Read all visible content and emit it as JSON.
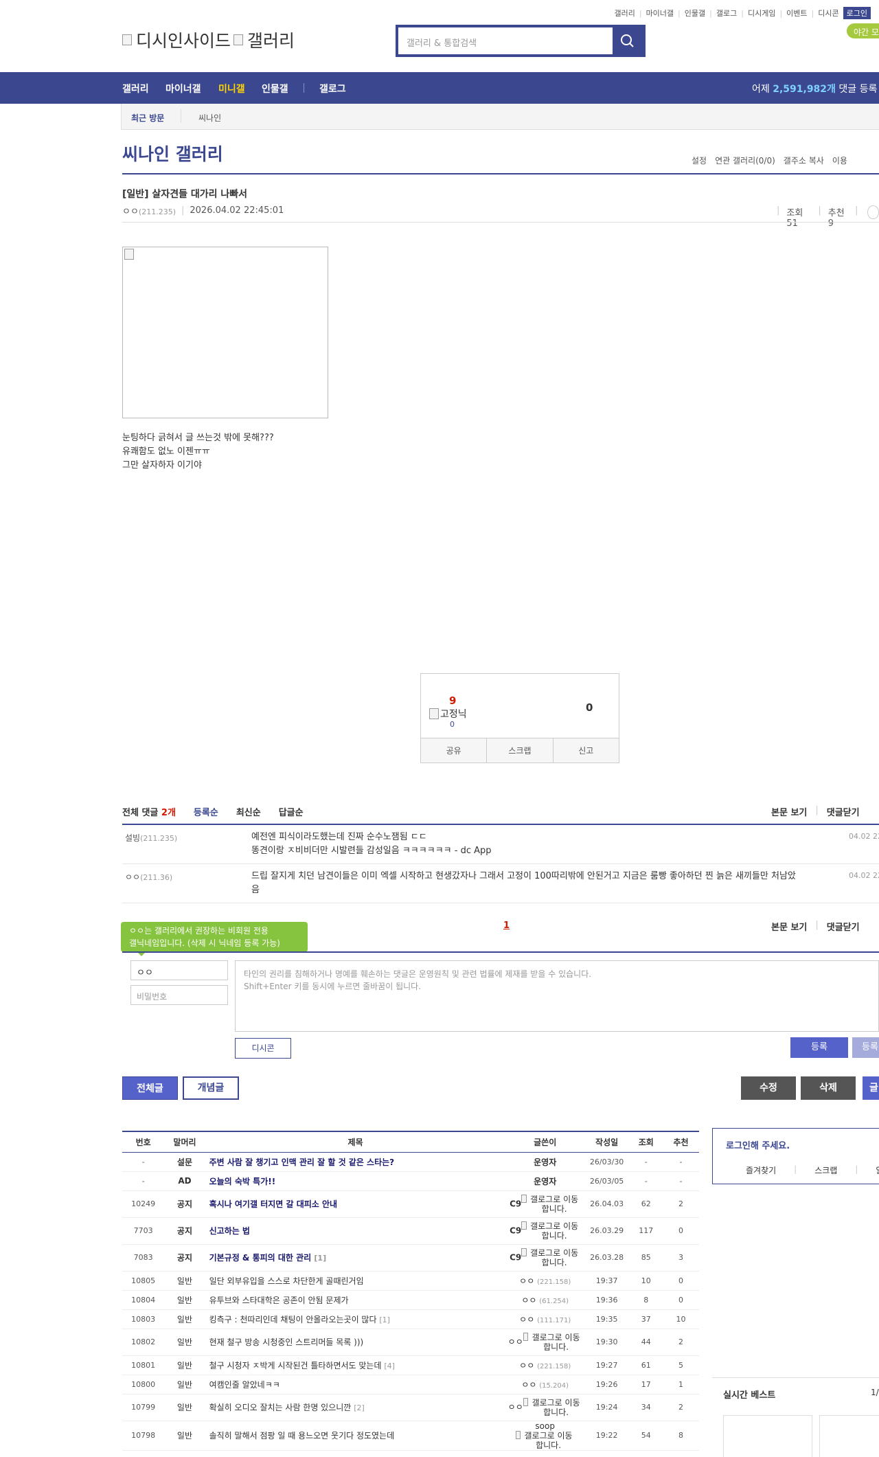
{
  "header": {
    "top_links": [
      "갤러리",
      "마이너갤",
      "인물갤",
      "갤로그",
      "디시게임",
      "이벤트",
      "디시콘"
    ],
    "login": "로그인",
    "logo_left": "디시인사이드",
    "logo_right": "갤러리",
    "search_placeholder": "갤러리 & 통합검색",
    "night_mode": "야간 모드"
  },
  "nav": {
    "items": [
      "갤러리",
      "마이너갤",
      "미니갤",
      "인물갤",
      "갤로그"
    ],
    "active": "미니갤",
    "stat_prefix": "어제",
    "stat_count": "2,591,982개",
    "stat_suffix": "댓글 등록"
  },
  "recent": {
    "label": "최근 방문",
    "item": "씨나인"
  },
  "gallery": {
    "title": "씨나인 갤러리",
    "tools": [
      "설정",
      "연관 갤러리(0/0)",
      "갤주소 복사",
      "이용"
    ]
  },
  "post": {
    "title": "[일반] 살자견들 대가리 나빠서",
    "author": "ㅇㅇ",
    "author_ip": "(211.235)",
    "datetime": "2026.04.02 22:45:01",
    "views": "조회 51",
    "recommend": "추천 9",
    "body_lines": [
      "눈팅하다 긁혀서 글 쓰는것 밖에 못해???",
      "유쾌함도 없노 이젠ㅠㅠ",
      "그만 살자하자 이기야"
    ]
  },
  "vote": {
    "up": "9",
    "fixed_nick": "고정닉",
    "fixed_count": "0",
    "down": "0",
    "buttons": [
      "공유",
      "스크랩",
      "신고"
    ]
  },
  "comments": {
    "total_label": "전체 댓글",
    "total_count": "2개",
    "sorts": [
      "등록순",
      "최신순",
      "답글순"
    ],
    "right_links": [
      "본문 보기",
      "댓글닫기"
    ],
    "list": [
      {
        "author": "설빙",
        "ip": "(211.235)",
        "text": "예전엔 피식이라도했는데 진짜 순수노잼됨 ㄷㄷ\n똥견이랑 ㅈ비비더만 시발련들 감성일음 ㅋㅋㅋㅋㅋㅋ - dc App",
        "date": "04.02 22"
      },
      {
        "author": "ㅇㅇ",
        "ip": "(211.36)",
        "text": "드립 잘지게 치던 남견이들은 이미 엑셀 시작하고 현생갔자나 그래서 고정이 100따리밖에 안된거고 지금은 룸빵 좋아하던 찐 늙은 새끼들만 처남았음",
        "date": "04.02 22"
      }
    ],
    "page": "1"
  },
  "comment_form": {
    "tooltip": "ㅇㅇ는 갤러리에서 권장하는 비회원 전용\n갤닉네임입니다. (삭제 시 닉네임 등록 가능)",
    "nick": "ㅇㅇ",
    "password_placeholder": "비밀번호",
    "textarea_placeholder": "타인의 권리를 침해하거나 명예를 훼손하는 댓글은 운영원칙 및 관련 법률에 제재를 받을 수 있습니다.\nShift+Enter 키를 동시에 누르면 줄바꿈이 됩니다.",
    "dccon": "디시콘",
    "submit": "등록",
    "submit2": "등록"
  },
  "buttons": {
    "all": "전체글",
    "concept": "개념글",
    "edit": "수정",
    "delete": "삭제",
    "write": "글"
  },
  "list": {
    "headers": [
      "번호",
      "말머리",
      "제목",
      "글쓴이",
      "작성일",
      "조회",
      "추천"
    ],
    "rows": [
      {
        "num": "-",
        "head": "설문",
        "title": "주변 사람 잘 챙기고 인맥 관리 잘 할 것 같은 스타는?",
        "reply": "",
        "writer": "운영자",
        "wip": "",
        "gallog": false,
        "date": "26/03/30",
        "views": "-",
        "rec": "-",
        "bold": true
      },
      {
        "num": "-",
        "head": "AD",
        "title": "오늘의 숙박 특가!!",
        "reply": "",
        "writer": "운영자",
        "wip": "",
        "gallog": false,
        "date": "26/03/05",
        "views": "-",
        "rec": "-",
        "bold": true
      },
      {
        "num": "10249",
        "head": "공지",
        "title": "혹시나 여기갤 터지면 갈 대피소 안내",
        "reply": "",
        "writer": "C9",
        "wip": "",
        "gallog": true,
        "date": "26.04.03",
        "views": "62",
        "rec": "2",
        "bold": true
      },
      {
        "num": "7703",
        "head": "공지",
        "title": "신고하는 법",
        "reply": "",
        "writer": "C9",
        "wip": "",
        "gallog": true,
        "date": "26.03.29",
        "views": "117",
        "rec": "0",
        "bold": true
      },
      {
        "num": "7083",
        "head": "공지",
        "title": "기본규정 & 통피의 대한 관리",
        "reply": "[1]",
        "writer": "C9",
        "wip": "",
        "gallog": true,
        "date": "26.03.28",
        "views": "85",
        "rec": "3",
        "bold": true
      },
      {
        "num": "10805",
        "head": "일반",
        "title": "일단 외부유입을 스스로 차단한게 골때린거임",
        "reply": "",
        "writer": "ㅇㅇ",
        "wip": "(221.158)",
        "gallog": false,
        "date": "19:37",
        "views": "10",
        "rec": "0",
        "bold": false
      },
      {
        "num": "10804",
        "head": "일반",
        "title": "유투브와 스타대학은 공존이 안됨 문제가",
        "reply": "",
        "writer": "ㅇㅇ",
        "wip": "(61.254)",
        "gallog": false,
        "date": "19:36",
        "views": "8",
        "rec": "0",
        "bold": false
      },
      {
        "num": "10803",
        "head": "일반",
        "title": "킹측구 : 천따리인데 채팅이 안올라오는곳이 많다",
        "reply": "[1]",
        "writer": "ㅇㅇ",
        "wip": "(111.171)",
        "gallog": false,
        "date": "19:35",
        "views": "37",
        "rec": "10",
        "bold": false
      },
      {
        "num": "10802",
        "head": "일반",
        "title": "현재 철구 방송 시청중인 스트리머들 목록 )))",
        "reply": "",
        "writer": "ㅇㅇ",
        "wip": "",
        "gallog": true,
        "date": "19:30",
        "views": "44",
        "rec": "2",
        "bold": false
      },
      {
        "num": "10801",
        "head": "일반",
        "title": "철구 시청자 ㅈ박게 시작된건 틀타하면서도 맞는데",
        "reply": "[4]",
        "writer": "ㅇㅇ",
        "wip": "(221.158)",
        "gallog": false,
        "date": "19:27",
        "views": "61",
        "rec": "5",
        "bold": false
      },
      {
        "num": "10800",
        "head": "일반",
        "title": "여캠인줄 알았네ㅋㅋ",
        "reply": "",
        "writer": "ㅇㅇ",
        "wip": "(15.204)",
        "gallog": false,
        "date": "19:26",
        "views": "17",
        "rec": "1",
        "bold": false
      },
      {
        "num": "10799",
        "head": "일반",
        "title": "확실히 오디오 잘치는 사람 한명 있으니깐",
        "reply": "[2]",
        "writer": "ㅇㅇ",
        "wip": "",
        "gallog": true,
        "date": "19:24",
        "views": "34",
        "rec": "2",
        "bold": false
      },
      {
        "num": "10798",
        "head": "일반",
        "title": "솔직히 말해서 점팡 일 때 용느오면 웃기다 정도였는데",
        "reply": "",
        "writer": "soop",
        "wip": "",
        "gallog": true,
        "date": "19:22",
        "views": "54",
        "rec": "8",
        "bold": false
      }
    ],
    "gallog_alt": "갤로그로 이동합니다."
  },
  "sidebar": {
    "login_prompt": "로그인해 주세요.",
    "login_links": [
      "즐겨찾기",
      "스크랩",
      "알림"
    ],
    "best_title": "실시간 베스트",
    "best_page": "1/"
  },
  "colors": {
    "primary": "#3b4890",
    "accent_yellow": "#ffd400",
    "night_green": "#a5c93f",
    "red": "#d31900"
  }
}
